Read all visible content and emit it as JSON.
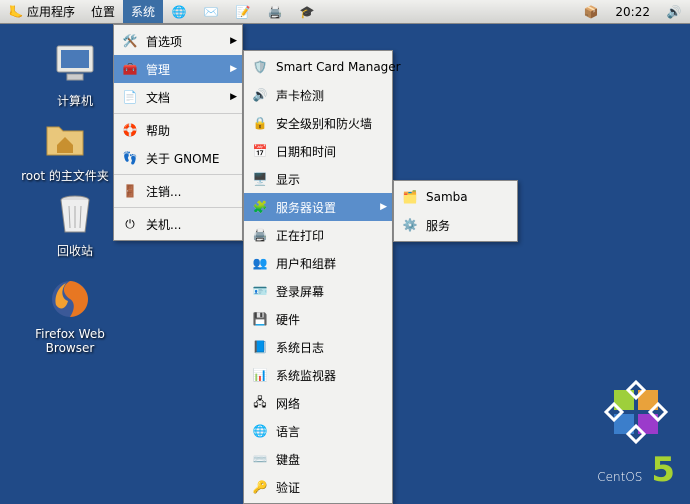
{
  "panel": {
    "apps": "应用程序",
    "places": "位置",
    "system": "系统",
    "clock": "20:22"
  },
  "icons": {
    "computer": "计算机",
    "home": "root 的主文件夹",
    "trash": "回收站",
    "firefox": "Firefox Web Browser"
  },
  "sysmenu": {
    "prefs": "首选项",
    "admin": "管理",
    "docs": "文档",
    "help": "帮助",
    "about": "关于 GNOME",
    "logout": "注销...",
    "shutdown": "关机..."
  },
  "adminmenu": {
    "smartcard": "Smart Card Manager",
    "sound": "声卡检测",
    "security": "安全级别和防火墙",
    "datetime": "日期和时间",
    "display": "显示",
    "serverset": "服务器设置",
    "printing": "正在打印",
    "usersgroups": "用户和组群",
    "loginscreen": "登录屏幕",
    "hardware": "硬件",
    "syslog": "系统日志",
    "sysmon": "系统监视器",
    "network": "网络",
    "language": "语言",
    "keyboard": "键盘",
    "auth": "验证"
  },
  "servermenu": {
    "samba": "Samba",
    "services": "服务"
  },
  "brand": {
    "name": "CentOS",
    "ver": "5"
  }
}
